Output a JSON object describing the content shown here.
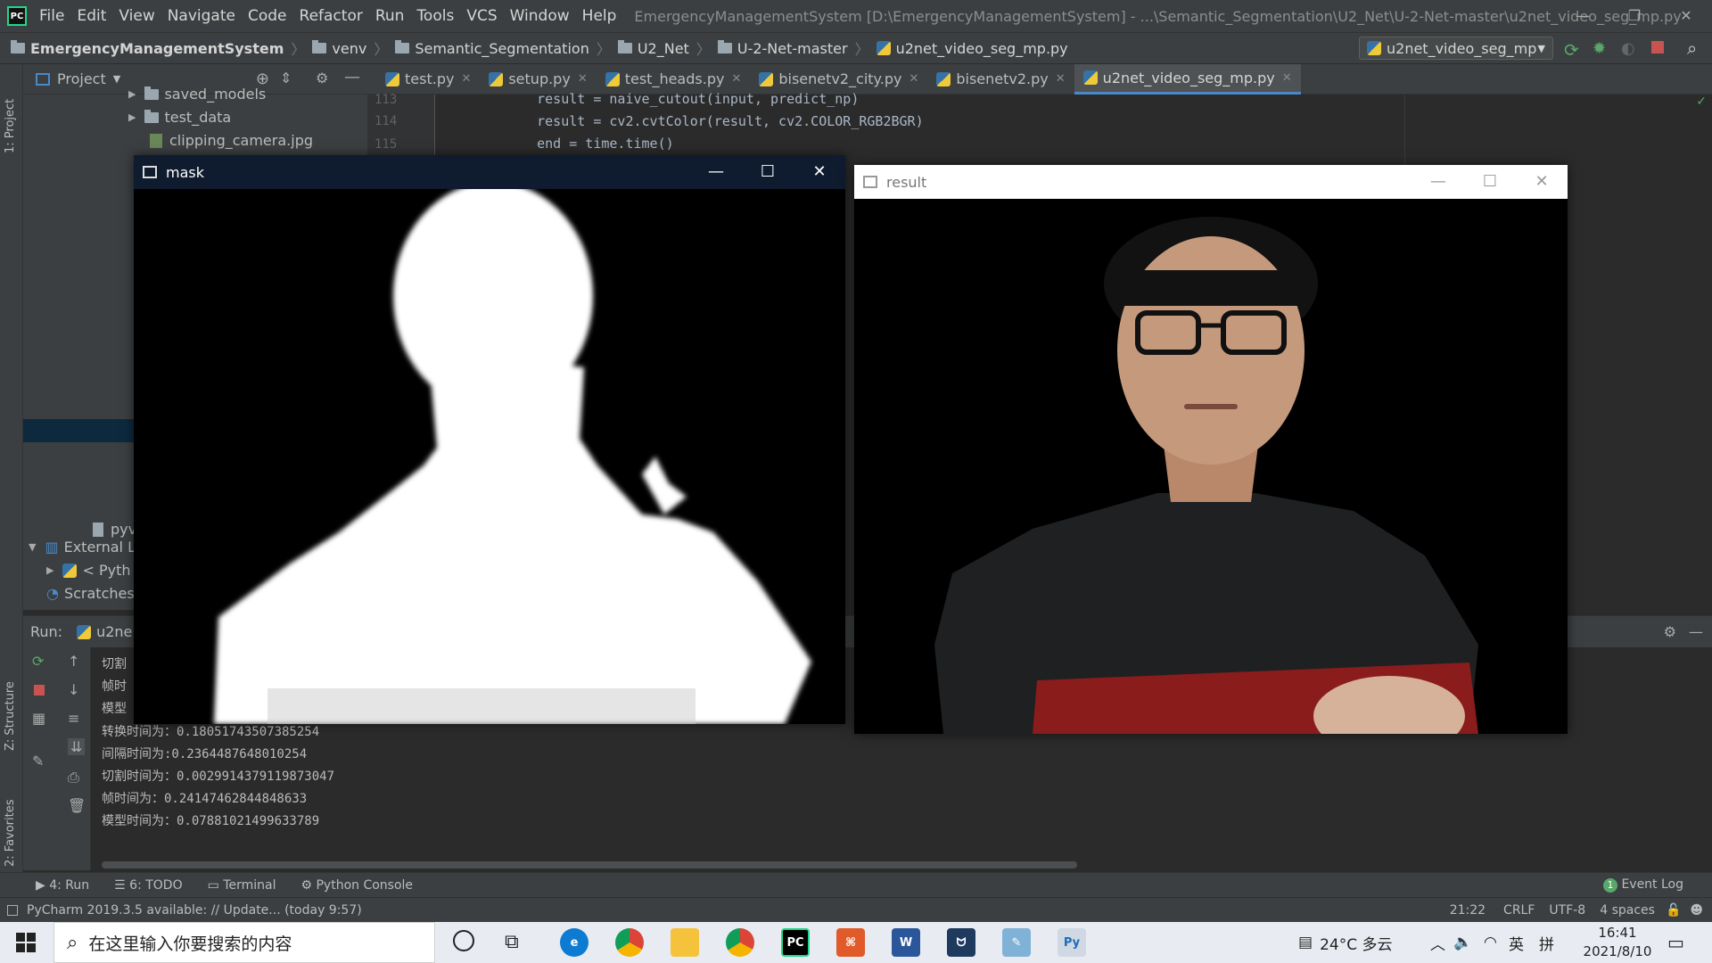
{
  "titlebar": {
    "menu": [
      "File",
      "Edit",
      "View",
      "Navigate",
      "Code",
      "Refactor",
      "Run",
      "Tools",
      "VCS",
      "Window",
      "Help"
    ],
    "window_title": "EmergencyManagementSystem [D:\\EmergencyManagementSystem] - ...\\Semantic_Segmentation\\U2_Net\\U-2-Net-master\\u2net_video_seg_mp.py"
  },
  "breadcrumb": [
    "EmergencyManagementSystem",
    "venv",
    "Semantic_Segmentation",
    "U2_Net",
    "U-2-Net-master",
    "u2net_video_seg_mp.py"
  ],
  "run_config": "u2net_video_seg_mp",
  "left_stripe": {
    "project": "1: Project",
    "structure": "Z: Structure",
    "favorites": "2: Favorites"
  },
  "project_panel": {
    "title": "Project",
    "items": [
      "saved_models",
      "test_data",
      "clipping_camera.jpg",
      "External Li",
      "< Pyth",
      "Scratches",
      "pyv"
    ]
  },
  "editor": {
    "tabs": [
      "test.py",
      "setup.py",
      "test_heads.py",
      "bisenetv2_city.py",
      "bisenetv2.py",
      "u2net_video_seg_mp.py"
    ],
    "lines": [
      {
        "no": "113",
        "text": "    result = naive_cutout(input, predict_np)"
      },
      {
        "no": "114",
        "text": "    result = cv2.cvtColor(result, cv2.COLOR_RGB2BGR)"
      },
      {
        "no": "115",
        "text": "    end = time.time()"
      }
    ]
  },
  "run_panel": {
    "label": "Run:",
    "tab": "u2ne",
    "hidden_lines": [
      "切割",
      "帧时",
      "模型"
    ],
    "lines": [
      "转换时间为：0.18051743507385254",
      "间隔时间为:0.2364487648010254",
      "切割时间为：0.0029914379119873047",
      "帧时间为：0.24147462844848633",
      "模型时间为：0.07881021499633789"
    ]
  },
  "bottom_tools": {
    "run": "4: Run",
    "todo": "6: TODO",
    "terminal": "Terminal",
    "python_console": "Python Console",
    "event_log": "Event Log",
    "event_count": "1"
  },
  "statusbar": {
    "message": "PyCharm 2019.3.5 available: // Update... (today 9:57)",
    "position": "21:22",
    "line_sep": "CRLF",
    "encoding": "UTF-8",
    "indent": "4 spaces"
  },
  "windows": {
    "mask": "mask",
    "result": "result"
  },
  "taskbar": {
    "search_placeholder": "在这里输入你要搜索的内容",
    "weather": "24°C 多云",
    "ime1": "英",
    "ime2": "拼",
    "time": "16:41",
    "date": "2021/8/10"
  }
}
